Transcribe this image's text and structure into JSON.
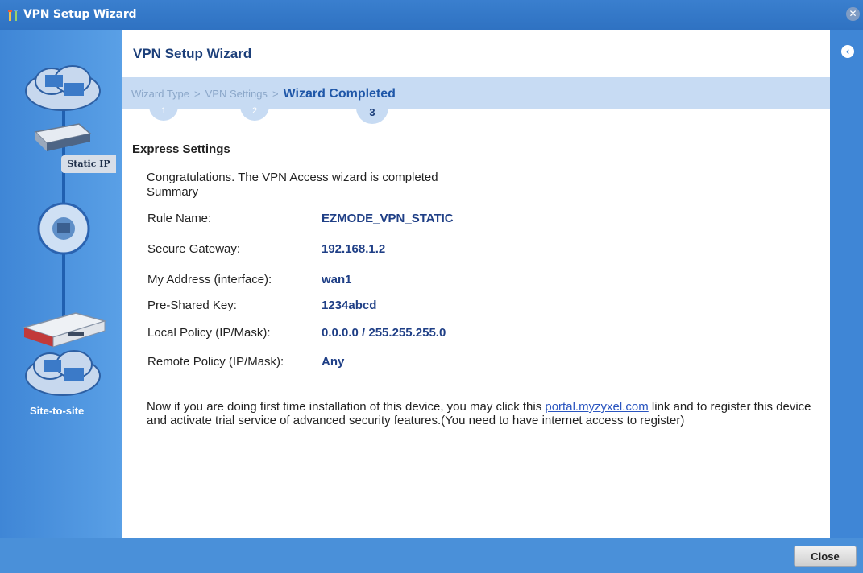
{
  "window": {
    "title": "VPN Setup Wizard"
  },
  "sidebar": {
    "static_ip_label": "Static IP",
    "site_to_site_label": "Site-to-site"
  },
  "main": {
    "title": "VPN Setup Wizard",
    "breadcrumb": {
      "step1": "Wizard Type",
      "step2": "VPN Settings",
      "step3": "Wizard Completed",
      "separator": ">"
    },
    "steps": {
      "n1": "1",
      "n2": "2",
      "n3": "3"
    },
    "section_title": "Express Settings",
    "congrats_line1": "Congratulations. The VPN Access wizard is completed",
    "congrats_line2": "Summary",
    "summary": [
      {
        "label": "Rule Name:",
        "value": "EZMODE_VPN_STATIC"
      },
      {
        "label": "Secure Gateway:",
        "value": "192.168.1.2"
      },
      {
        "label": "My Address (interface):",
        "value": "wan1"
      },
      {
        "label": "Pre-Shared Key:",
        "value": "1234abcd"
      },
      {
        "label": "Local Policy (IP/Mask):",
        "value": "0.0.0.0 / 255.255.255.0"
      },
      {
        "label": "Remote Policy (IP/Mask):",
        "value": "Any"
      }
    ],
    "note_before": "Now if you are doing first time installation of this device, you may click this ",
    "note_link": "portal.myzyxel.com",
    "note_after": " link and to register this device and activate trial service of advanced security features.(You need to have internet access to register)"
  },
  "footer": {
    "close_label": "Close"
  },
  "colors": {
    "accent": "#4a90d9",
    "title_text": "#1c3f7a",
    "value_text": "#1f3f86",
    "wizard_bar": "#c7dbf3"
  }
}
